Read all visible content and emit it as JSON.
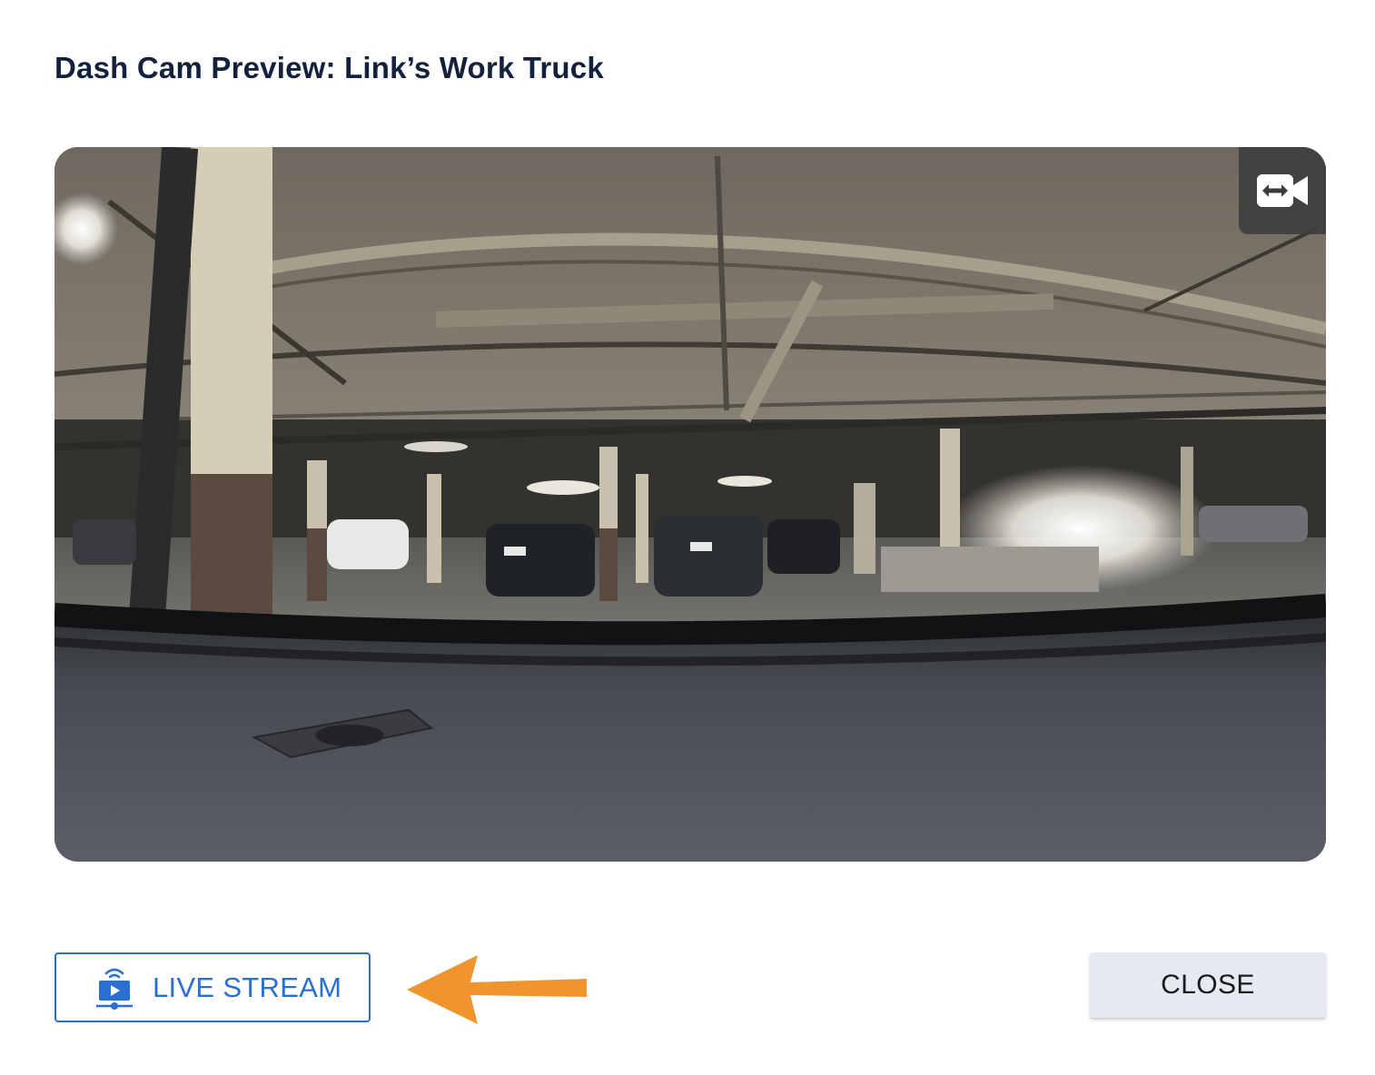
{
  "dialog": {
    "title": "Dash Cam Preview: Link’s Work Truck"
  },
  "preview": {
    "icon": "swap-camera-icon"
  },
  "actions": {
    "live_stream_label": "LIVE STREAM",
    "live_stream_icon": "live-stream-icon",
    "close_label": "CLOSE",
    "arrow_icon": "arrow-left-icon"
  },
  "colors": {
    "accent": "#2a6fd1",
    "title": "#14213d",
    "close_bg": "#e6e9f1",
    "arrow": "#f0952d"
  }
}
